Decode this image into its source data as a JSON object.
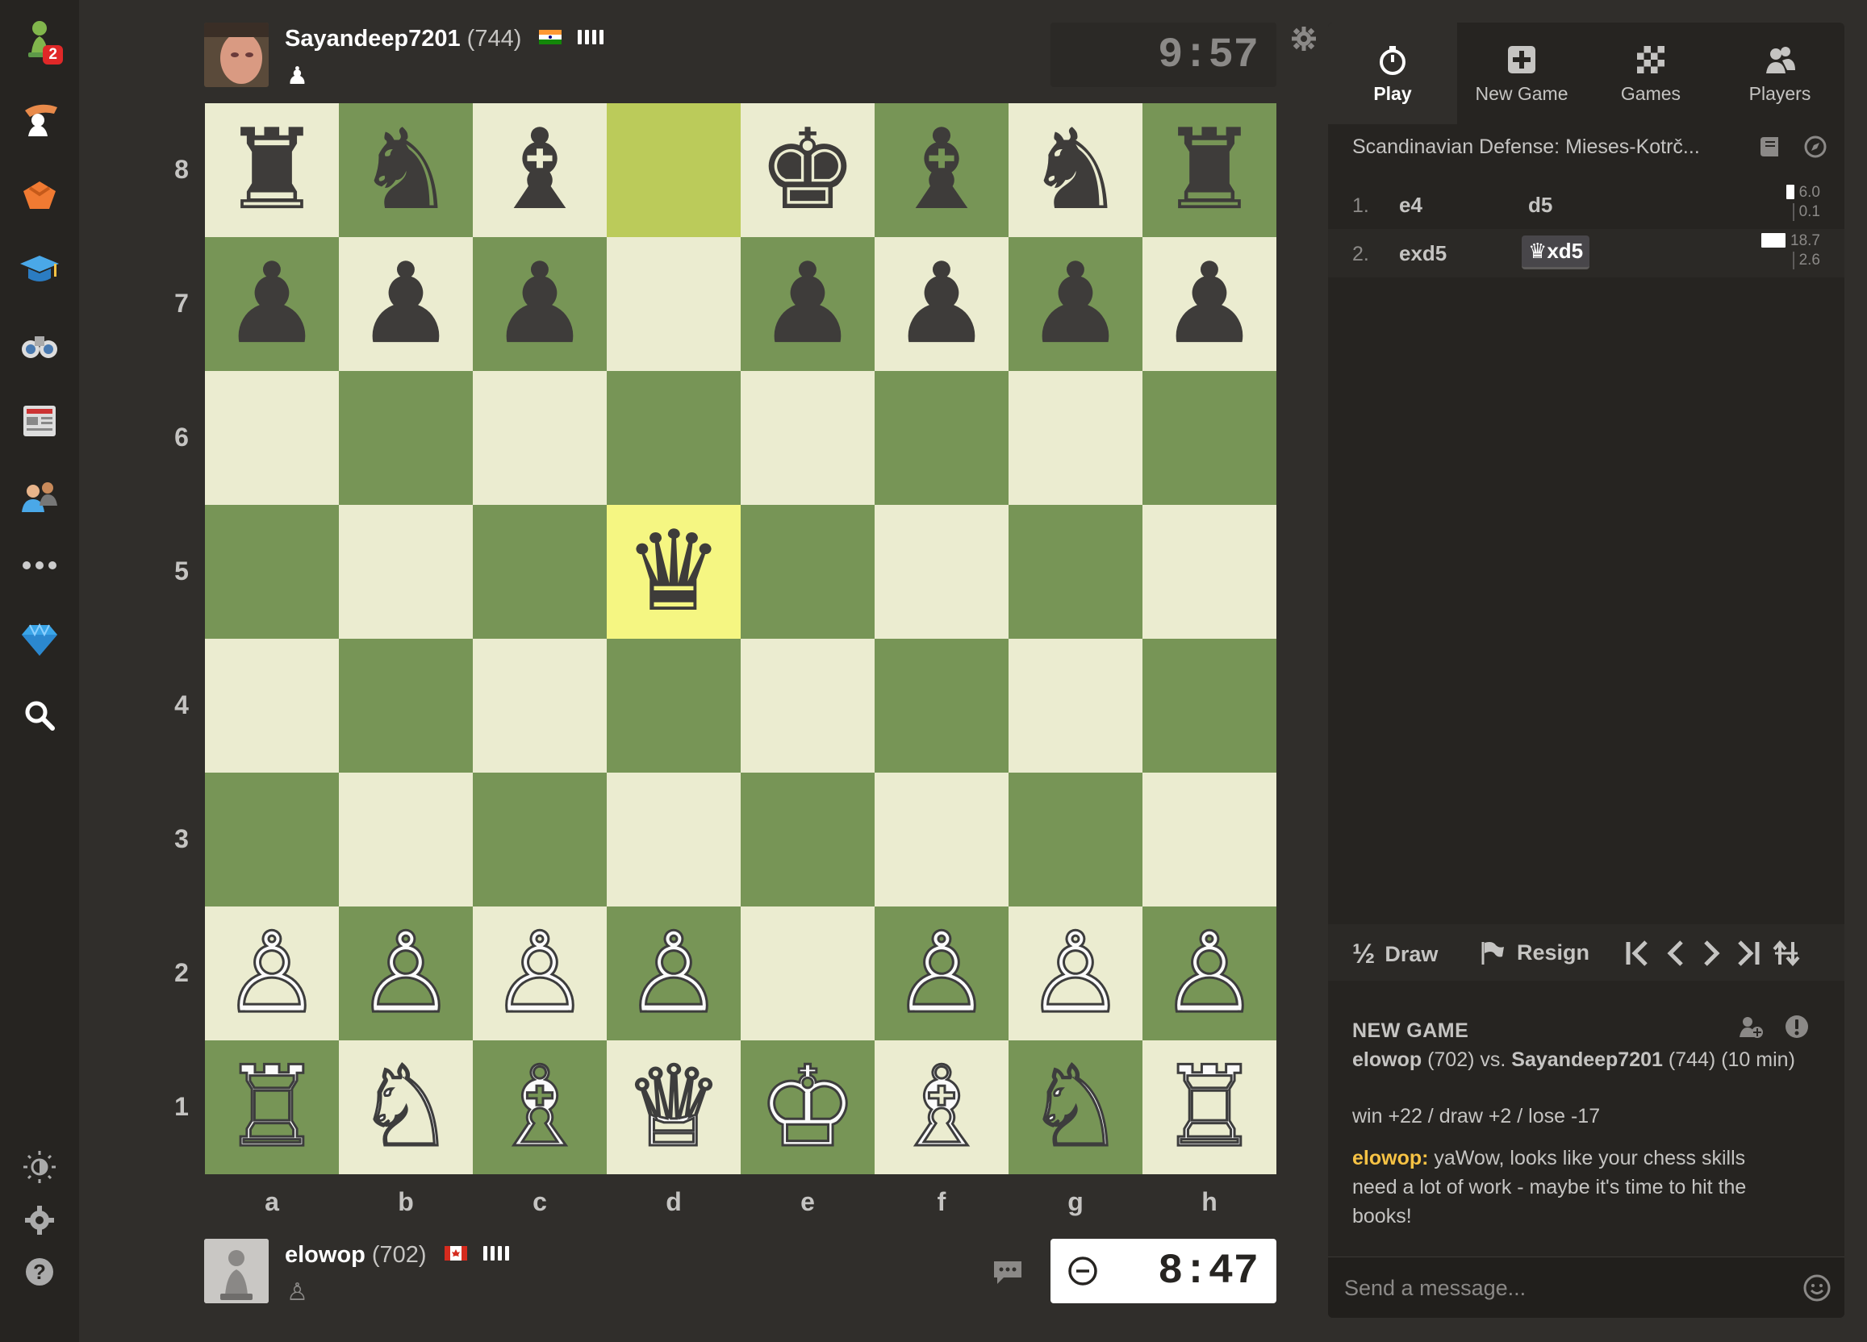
{
  "sidebar": {
    "badge": "2",
    "items": [
      "play-icon",
      "puzzles-icon",
      "train-icon",
      "learn-icon",
      "watch-icon",
      "news-icon",
      "social-icon",
      "more-icon",
      "premium-icon",
      "search-icon",
      "theme-icon",
      "settings-icon",
      "help-icon"
    ]
  },
  "top_player": {
    "name": "Sayandeep7201",
    "rating": "(744)",
    "flag": "India",
    "clock": "9:57",
    "captured": "♟"
  },
  "bottom_player": {
    "name": "elowop",
    "rating": "(702)",
    "flag": "Canada",
    "clock": "8:47",
    "captured": "♙"
  },
  "board": {
    "ranks": [
      "8",
      "7",
      "6",
      "5",
      "4",
      "3",
      "2",
      "1"
    ],
    "files": [
      "a",
      "b",
      "c",
      "d",
      "e",
      "f",
      "g",
      "h"
    ],
    "highlight_squares": [
      "d8",
      "d5"
    ],
    "position": [
      [
        "♜",
        "♞",
        "♝",
        "",
        "♚",
        "♝",
        "♞",
        "♜"
      ],
      [
        "♟",
        "♟",
        "♟",
        "",
        "♟",
        "♟",
        "♟",
        "♟"
      ],
      [
        "",
        "",
        "",
        "",
        "",
        "",
        "",
        ""
      ],
      [
        "",
        "",
        "",
        "♛",
        "",
        "",
        "",
        ""
      ],
      [
        "",
        "",
        "",
        "",
        "",
        "",
        "",
        ""
      ],
      [
        "",
        "",
        "",
        "",
        "",
        "",
        "",
        ""
      ],
      [
        "♙",
        "♙",
        "♙",
        "♙",
        "",
        "♙",
        "♙",
        "♙"
      ],
      [
        "♖",
        "♘",
        "♗",
        "♕",
        "♔",
        "♗",
        "♘",
        "♖"
      ]
    ]
  },
  "tabs": [
    {
      "label": "Play",
      "icon": "stopwatch-icon",
      "active": true
    },
    {
      "label": "New Game",
      "icon": "plus-icon",
      "active": false
    },
    {
      "label": "Games",
      "icon": "checkerboard-icon",
      "active": false
    },
    {
      "label": "Players",
      "icon": "players-icon",
      "active": false
    }
  ],
  "opening": "Scandinavian Defense: Mieses-Kotrč...",
  "moves": [
    {
      "num": "1.",
      "white": "e4",
      "black": "d5",
      "t_white": "6.0",
      "t_black": "0.1",
      "bar_frac": 0.32
    },
    {
      "num": "2.",
      "white": "exd5",
      "black": "xd5",
      "black_piece": "♛",
      "t_white": "18.7",
      "t_black": "2.6",
      "bar_frac": 1.0
    }
  ],
  "controls": {
    "draw": "Draw",
    "draw_symbol": "½",
    "resign": "Resign"
  },
  "chat": {
    "heading": "NEW GAME",
    "vs_white": "elowop",
    "vs_white_rating": "(702)",
    "vs_word": "vs.",
    "vs_black": "Sayandeep7201",
    "vs_black_rating": "(744)",
    "time_control": "(10 min)",
    "stakes": "win +22 / draw +2 / lose -17",
    "msg_author": "elowop:",
    "msg_text": "yaWow, looks like your chess skills need a lot of work - maybe it's time to hit the books!",
    "placeholder": "Send a message..."
  },
  "colors": {
    "light_square": "#ebecd0",
    "dark_square": "#779556",
    "highlight_light": "#f5f682",
    "highlight_dark": "#bbcb5a",
    "background": "#302e2b",
    "panel": "#262421"
  }
}
